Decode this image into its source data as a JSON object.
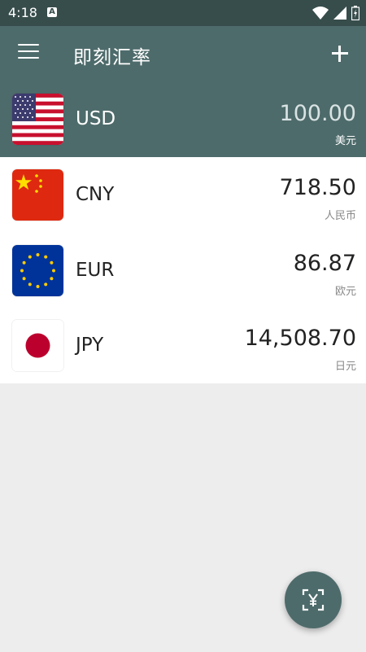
{
  "status_bar": {
    "time": "4:18",
    "notification_letter": "A"
  },
  "app_bar": {
    "title": "即刻汇率"
  },
  "base_currency": {
    "code": "USD",
    "amount": "100.00",
    "name": "美元",
    "flag_icon": "us-flag-icon"
  },
  "currencies": [
    {
      "code": "CNY",
      "amount": "718.50",
      "name": "人民币",
      "flag_icon": "cn-flag-icon"
    },
    {
      "code": "EUR",
      "amount": "86.87",
      "name": "欧元",
      "flag_icon": "eu-flag-icon"
    },
    {
      "code": "JPY",
      "amount": "14,508.70",
      "name": "日元",
      "flag_icon": "jp-flag-icon"
    }
  ],
  "fab": {
    "icon": "yuan-scan-icon"
  },
  "colors": {
    "primary": "#4e6b6b",
    "status_bar": "#374d4c",
    "background": "#ededed"
  }
}
